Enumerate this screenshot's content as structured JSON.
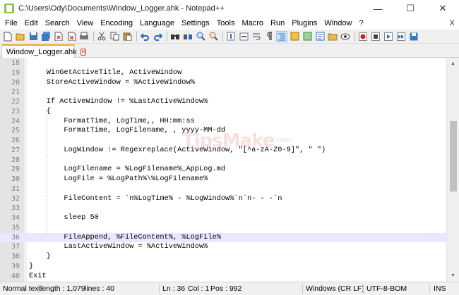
{
  "window": {
    "title": "C:\\Users\\Ody\\Documents\\Window_Logger.ahk - Notepad++",
    "minimize": "—",
    "maximize": "☐",
    "close": "✕"
  },
  "menu": {
    "items": [
      "File",
      "Edit",
      "Search",
      "View",
      "Encoding",
      "Language",
      "Settings",
      "Tools",
      "Macro",
      "Run",
      "Plugins",
      "Window",
      "?"
    ],
    "close_doc": "X"
  },
  "toolbar": {
    "icons": [
      "new-file-icon",
      "open-file-icon",
      "save-icon",
      "save-all-icon",
      "close-icon",
      "close-all-icon",
      "print-icon",
      "cut-icon",
      "copy-icon",
      "paste-icon",
      "undo-icon",
      "redo-icon",
      "find-icon",
      "replace-icon",
      "zoom-in-icon",
      "zoom-out-icon",
      "sync-vertical-icon",
      "sync-horizontal-icon",
      "word-wrap-icon",
      "show-all-chars-icon",
      "indent-guide-icon",
      "user-lang-icon",
      "doc-map-icon",
      "function-list-icon",
      "folder-workspace-icon",
      "monitor-icon",
      "record-macro-icon",
      "stop-macro-icon",
      "play-macro-icon",
      "run-macro-multiple-icon",
      "save-macro-icon"
    ]
  },
  "tabs": [
    {
      "label": "Window_Logger.ahk"
    }
  ],
  "editor": {
    "current_line": 36,
    "lines": [
      {
        "n": "18",
        "text": ""
      },
      {
        "n": "19",
        "text": "    WinGetActiveTitle, ActiveWindow"
      },
      {
        "n": "20",
        "text": "    StoreActiveWindow = %ActiveWindow%"
      },
      {
        "n": "21",
        "text": ""
      },
      {
        "n": "22",
        "text": "    If ActiveWindow != %LastActiveWindow%"
      },
      {
        "n": "23",
        "text": "    {"
      },
      {
        "n": "24",
        "text": "        FormatTime, LogTime,, HH:mm:ss"
      },
      {
        "n": "25",
        "text": "        FormatTime, LogFilename, , yyyy-MM-dd"
      },
      {
        "n": "26",
        "text": ""
      },
      {
        "n": "27",
        "text": "        LogWindow := Regexreplace(ActiveWindow, \"[^a-zA-Z0-9]\", \" \")"
      },
      {
        "n": "28",
        "text": ""
      },
      {
        "n": "29",
        "text": "        LogFilename = %LogFilename%_AppLog.md"
      },
      {
        "n": "30",
        "text": "        LogFile = %LogPath%\\%LogFilename%"
      },
      {
        "n": "31",
        "text": ""
      },
      {
        "n": "32",
        "text": "        FileContent = `n%LogTime% - %LogWindow%`n`n- - -`n"
      },
      {
        "n": "33",
        "text": ""
      },
      {
        "n": "34",
        "text": "        sleep 50"
      },
      {
        "n": "35",
        "text": ""
      },
      {
        "n": "36",
        "text": "        FileAppend, %FileContent%, %LogFile%"
      },
      {
        "n": "37",
        "text": "        LastActiveWindow = %ActiveWindow%"
      },
      {
        "n": "38",
        "text": "    }"
      },
      {
        "n": "39",
        "text": "}"
      },
      {
        "n": "40",
        "text": "Exit"
      }
    ]
  },
  "watermark": {
    "brand": "TipsMake",
    "suffix": ".com"
  },
  "status": {
    "file_type": "Normal text",
    "length": "length : 1,079",
    "lines": "lines : 40",
    "ln": "Ln : 36",
    "col": "Col : 1",
    "pos": "Pos : 992",
    "eol": "Windows (CR LF)",
    "encoding": "UTF-8-BOM",
    "mode": "INS"
  },
  "colors": {
    "current_line_bg": "#e8e8ff",
    "tab_accent": "#f5a623",
    "gutter_bg": "#e4e4e4"
  }
}
